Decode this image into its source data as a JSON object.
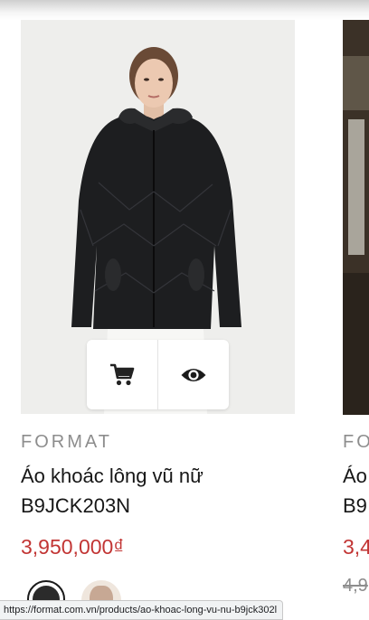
{
  "products": [
    {
      "brand": "FORMAT",
      "name_line1": "Áo khoác lông vũ nữ",
      "name_line2": "B9JCK203N",
      "price": "3,950,000₫",
      "colors": [
        "black",
        "beige"
      ]
    },
    {
      "brand": "FO",
      "name_line1": "Áo",
      "name_line2": "B9",
      "price": "3,4",
      "old_price": "4,9"
    }
  ],
  "actions": {
    "cart_icon": "cart-icon",
    "view_icon": "eye-icon"
  },
  "status_url": "https://format.com.vn/products/ao-khoac-long-vu-nu-b9jck302l",
  "colors": {
    "price": "#c23534",
    "brand": "#8d8d8d",
    "text": "#161616"
  }
}
